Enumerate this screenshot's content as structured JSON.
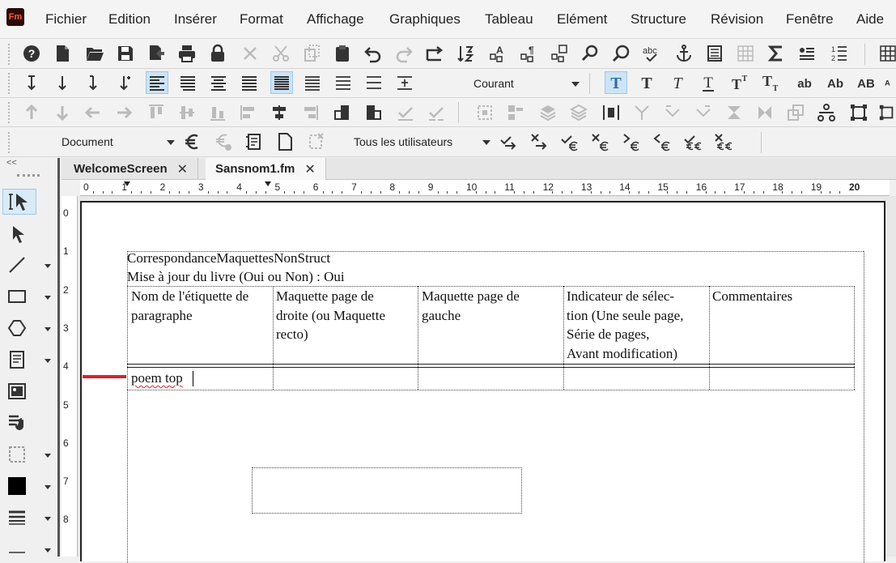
{
  "app": {
    "logo": "Fm"
  },
  "menu": [
    "Fichier",
    "Edition",
    "Insérer",
    "Format",
    "Affichage",
    "Graphiques",
    "Tableau",
    "Elément",
    "Structure",
    "Révision",
    "Fenêtre",
    "Aide"
  ],
  "toolbar_format": {
    "paragraph_style": "Courant"
  },
  "toolbar_track": {
    "view": "Document",
    "users": "Tous les utilisateurs"
  },
  "tabs": [
    {
      "label": "WelcomeScreen",
      "close": "✕"
    },
    {
      "label": "Sansnom1.fm",
      "close": "✕"
    }
  ],
  "palette": {
    "collapse": "<<"
  },
  "ruler_h": [
    "0",
    "1",
    "2",
    "3",
    "4",
    "5",
    "6",
    "7",
    "8",
    "9",
    "10",
    "11",
    "12",
    "13",
    "14",
    "15",
    "16",
    "17",
    "18",
    "19",
    "20"
  ],
  "ruler_v": [
    "0",
    "1",
    "2",
    "3",
    "4",
    "5",
    "6",
    "7",
    "8"
  ],
  "document": {
    "title": "CorrespondanceMaquettesNonStruct",
    "book_update": "Mise à jour du livre (Oui ou Non) : Oui",
    "table": {
      "headers": [
        "Nom de l'étiquette de paragraphe",
        "Maquette page de droite (ou Maquette recto)",
        "Maquette page de gauche",
        "Indicateur de sélec-tion (Une seule page, Série de pages, Avant modification)",
        "Commentaires"
      ],
      "header_lines": [
        [
          "Nom de l'étiquette de",
          "paragraphe"
        ],
        [
          "Maquette page de",
          "droite (ou Maquette",
          "recto)"
        ],
        [
          "Maquette page de",
          "gauche"
        ],
        [
          "Indicateur de sélec-",
          "tion (Une seule page,",
          "Série de pages,",
          "Avant modification)"
        ],
        [
          "Commentaires"
        ]
      ],
      "rows": [
        [
          "poem top",
          "",
          "",
          "",
          ""
        ]
      ]
    }
  },
  "colors": {
    "accent_active": "#cde3f6",
    "cursor_marker": "#d9232a",
    "logo_bg": "#2b0b07",
    "logo_fg": "#ff5a3c"
  }
}
